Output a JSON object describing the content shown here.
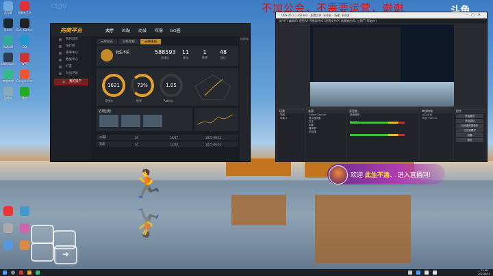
{
  "overlay": {
    "watermark": "csgo",
    "notice": "不加公会，不需要运营，谢谢",
    "streamer_logo": "斗鱼"
  },
  "desktop_icons": [
    {
      "label": "此电脑",
      "color": "#6fa8dc"
    },
    {
      "label": "网易云音乐",
      "color": "#d33"
    },
    {
      "label": "Steam",
      "color": "#1b2838"
    },
    {
      "label": "Epic Games",
      "color": "#222"
    },
    {
      "label": "网易UU",
      "color": "#3a9"
    },
    {
      "label": "QQ",
      "color": "#29c"
    },
    {
      "label": "Wallpaper",
      "color": "#2c3e50"
    },
    {
      "label": "WPS",
      "color": "#c33"
    },
    {
      "label": "哔哩哔哩",
      "color": "#3b8"
    },
    {
      "label": "Google Chrome",
      "color": "#e53"
    },
    {
      "label": "回收站",
      "color": "#8ab"
    },
    {
      "label": "微信",
      "color": "#2a2"
    }
  ],
  "game": {
    "logo": "完美平台",
    "nav": [
      "大厅",
      "匹配",
      "商城",
      "军需",
      "GO圈"
    ],
    "nav_active": 0,
    "sidebar": [
      "我的首页",
      "排行榜",
      "赛事中心",
      "数据中心",
      "好友",
      "对战记录",
      "我的资产"
    ],
    "sidebar_highlight": 6,
    "tabs": [
      "天梯总览",
      "竞技数据",
      "天梯排位"
    ],
    "tab_active": 2,
    "player_name": "此生不渝",
    "top_stats": [
      {
        "value": "588593",
        "label": "总场次"
      },
      {
        "value": "11",
        "label": "胜场"
      },
      {
        "value": "1",
        "label": "MVP"
      },
      {
        "value": "48",
        "label": "段位"
      }
    ],
    "rings": [
      {
        "value": "1621",
        "label": "天梯分"
      },
      {
        "value": "73%",
        "label": "胜率"
      },
      {
        "value": "1.05",
        "label": "Rating"
      }
    ],
    "recent_title": "近期战绩",
    "rows": [
      {
        "map": "沙漠2",
        "score": "16",
        "kd": "16/17",
        "time": "2021-06-13"
      },
      {
        "map": "荒漠",
        "score": "14",
        "kd": "12/18",
        "time": "2021-06-12"
      }
    ],
    "right_panel_title": "好友列表"
  },
  "obs": {
    "title": "OBS 26.1.1 (64-bit) - 配置文件: 未命名 - 场景: 未命名",
    "menu": "文件(F)  编辑(E)  视图(V)  停靠部件(D)  配置文件(P)  场景集合(S)  工具(T)  帮助(H)",
    "docks": [
      {
        "title": "场景",
        "items": [
          "场景",
          "场景 2"
        ]
      },
      {
        "title": "来源",
        "items": [
          "Game Capture",
          "显示器采集",
          "文本",
          "图像",
          "媒体源",
          "浏览器"
        ]
      },
      {
        "title": "混音器",
        "items": [
          "桌面音频",
          "麦克风/Aux"
        ]
      },
      {
        "title": "转场特效",
        "items": [
          "淡入淡出",
          "时长 300 ms"
        ]
      },
      {
        "title": "控件",
        "items": [
          "开始推流",
          "开始录制",
          "启动虚拟摄像机",
          "工作室模式",
          "设置",
          "退出"
        ]
      }
    ],
    "status": "LIVE: 01:23:45   REC: 00:00:00   CPU: 6.2%, 60.00 fps"
  },
  "welcome": {
    "prefix": "欢迎",
    "user": "此生不渝、",
    "suffix": "进入直播间!"
  },
  "taskbar": {
    "time": "21:48",
    "date": "2021/6/13"
  }
}
